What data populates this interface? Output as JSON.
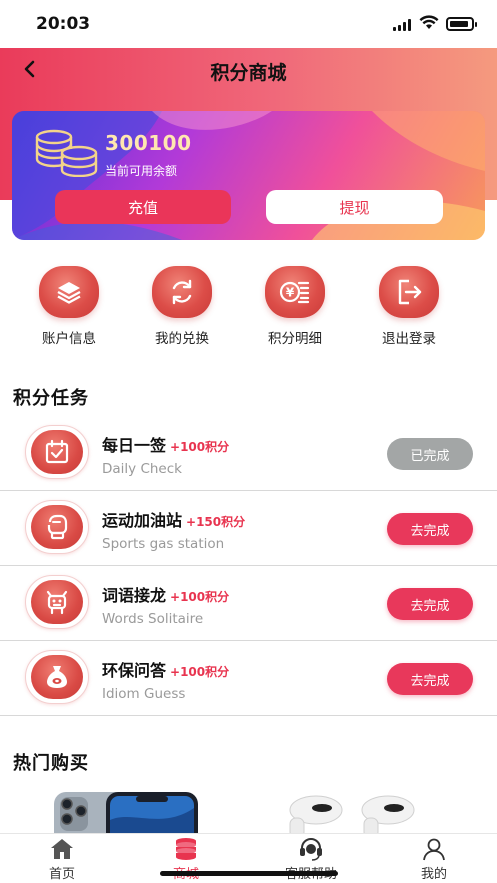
{
  "status_bar": {
    "time": "20:03"
  },
  "header": {
    "title": "积分商城",
    "back_icon": "chevron-left-icon"
  },
  "balance": {
    "amount": "300100",
    "label": "当前可用余额",
    "recharge_label": "充值",
    "withdraw_label": "提现",
    "icon": "coins-icon"
  },
  "quick_actions": [
    {
      "label": "账户信息",
      "icon": "layers-icon"
    },
    {
      "label": "我的兑换",
      "icon": "refresh-icon"
    },
    {
      "label": "积分明细",
      "icon": "yen-ledger-icon"
    },
    {
      "label": "退出登录",
      "icon": "logout-icon"
    }
  ],
  "tasks_section": {
    "title": "积分任务"
  },
  "tasks": [
    {
      "name": "每日一签",
      "points": "+100积分",
      "subtitle": "Daily Check",
      "button": "已完成",
      "status": "done",
      "icon": "calendar-check-icon"
    },
    {
      "name": "运动加油站",
      "points": "+150积分",
      "subtitle": "Sports gas station",
      "button": "去完成",
      "status": "todo",
      "icon": "boxing-glove-icon"
    },
    {
      "name": "词语接龙",
      "points": "+100积分",
      "subtitle": "Words Solitaire",
      "button": "去完成",
      "status": "todo",
      "icon": "dragon-icon"
    },
    {
      "name": "环保问答",
      "points": "+100积分",
      "subtitle": "Idiom Guess",
      "button": "去完成",
      "status": "todo",
      "icon": "money-bag-icon"
    }
  ],
  "hot_section": {
    "title": "热门购买"
  },
  "tabbar": {
    "items": [
      {
        "label": "首页",
        "icon": "home-icon"
      },
      {
        "label": "商城",
        "icon": "coin-stack-icon",
        "active": true
      },
      {
        "label": "客服帮助",
        "icon": "headset-icon"
      },
      {
        "label": "我的",
        "icon": "user-icon"
      }
    ]
  },
  "colors": {
    "accent": "#e8344f",
    "button_done": "#a3a6a6",
    "header_gradient_start": "#ea3b5a",
    "header_gradient_end": "#f59a7e"
  }
}
